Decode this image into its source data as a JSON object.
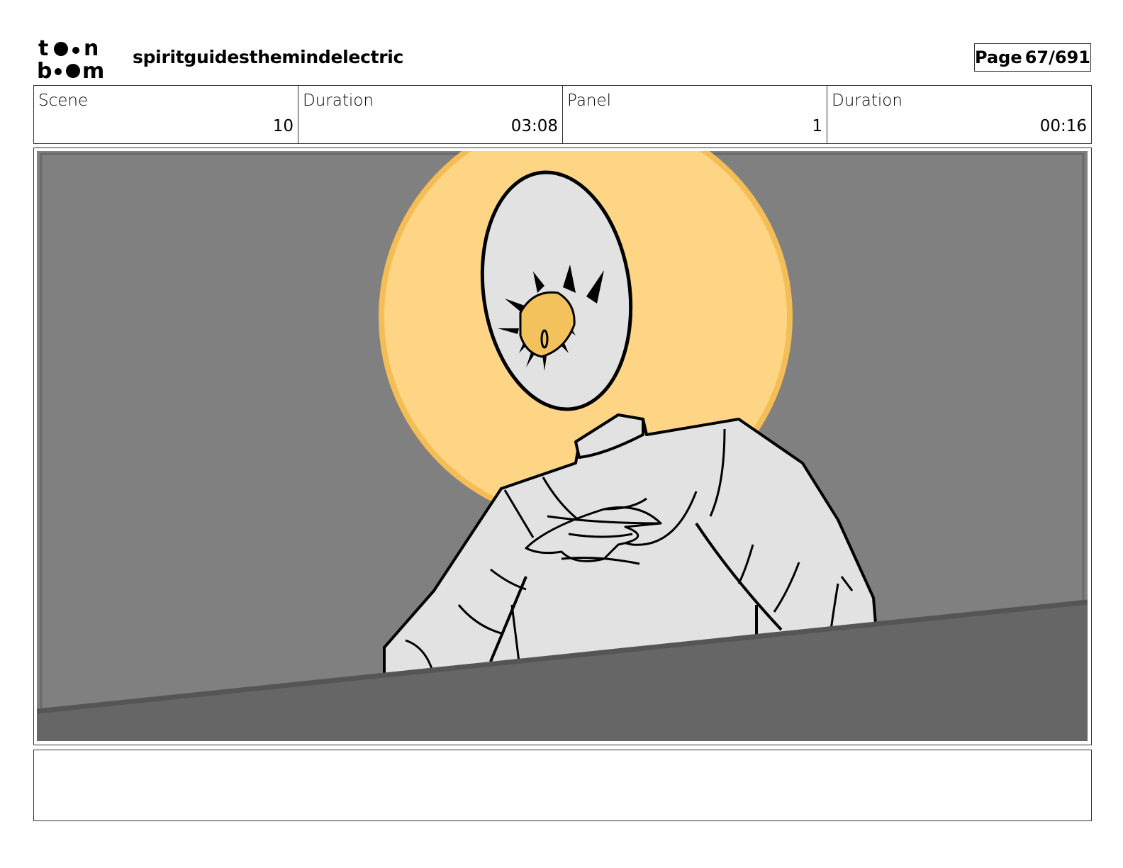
{
  "header": {
    "logo_line1": "toon",
    "logo_line2": "boom",
    "project_title": "spiritguidesthemindelectric",
    "page_label": "Page",
    "page_value": "67/691"
  },
  "info": {
    "scene_label": "Scene",
    "scene_value": "10",
    "scene_duration_label": "Duration",
    "scene_duration_value": "03:08",
    "panel_label": "Panel",
    "panel_value": "1",
    "panel_duration_label": "Duration",
    "panel_duration_value": "00:16"
  },
  "colors": {
    "background_gray": "#808080",
    "foreground_gray": "#666666",
    "halo": "#fdd584",
    "halo_edge": "#f4bd55",
    "figure": "#e2e2e2",
    "eye": "#f3c25c",
    "ink": "#000000"
  },
  "notes": ""
}
